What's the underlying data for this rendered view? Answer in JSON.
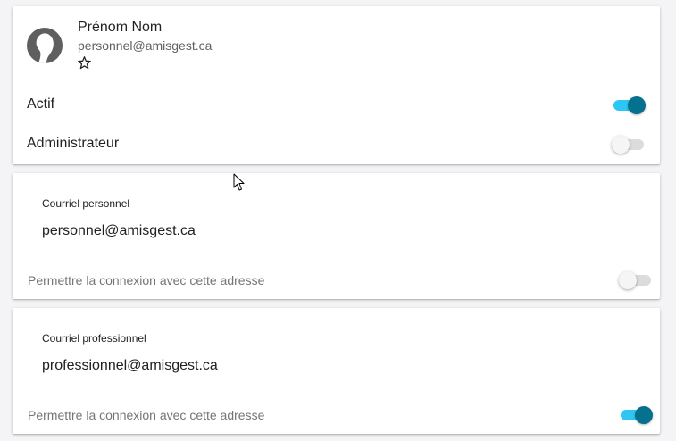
{
  "user": {
    "name": "Prénom Nom",
    "email": "personnel@amisgest.ca",
    "favorite_icon": "star-outline-icon",
    "avatar_icon": "user-silhouette-icon"
  },
  "settings": [
    {
      "label": "Actif",
      "enabled": true
    },
    {
      "label": "Administrateur",
      "enabled": false
    }
  ],
  "personal_email": {
    "label": "Courriel personnel",
    "value": "personnel@amisgest.ca",
    "login_label": "Permettre la connexion avec cette adresse",
    "login_enabled": false
  },
  "professional_email": {
    "label": "Courriel professionnel",
    "value": "professionnel@amisgest.ca",
    "login_label": "Permettre la connexion avec cette adresse",
    "login_enabled": true
  },
  "colors": {
    "toggle_on_track": "#2ec6f2",
    "toggle_on_thumb": "#06708f",
    "toggle_off_track": "#dcdcdc",
    "toggle_off_thumb": "#f5f5f5"
  }
}
